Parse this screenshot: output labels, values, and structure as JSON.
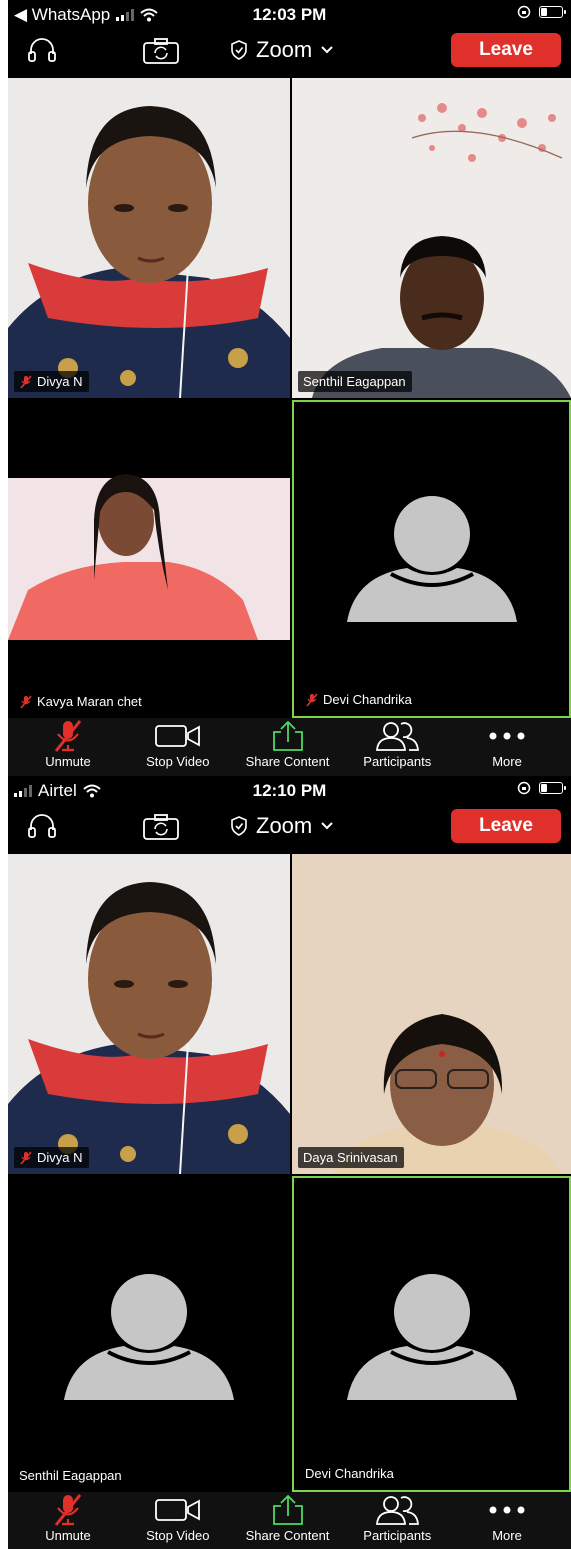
{
  "screens": [
    {
      "status": {
        "left_label": "◀ WhatsApp",
        "time": "12:03 PM"
      },
      "meeting": {
        "title": "Zoom",
        "leave_label": "Leave"
      },
      "tiles": [
        {
          "name": "Divya N",
          "muted": true,
          "video": "divya"
        },
        {
          "name": "Senthil Eagappan",
          "muted": false,
          "video": "senthil"
        },
        {
          "name": "Kavya Maran chet",
          "muted": true,
          "video": "kavya"
        },
        {
          "name": "Devi Chandrika",
          "muted": true,
          "video": "avatar",
          "active": true
        }
      ],
      "toolbar": {
        "unmute": "Unmute",
        "stop_video": "Stop Video",
        "share_content": "Share Content",
        "participants": "Participants",
        "more": "More"
      }
    },
    {
      "status": {
        "left_label": "Airtel",
        "time": "12:10 PM"
      },
      "meeting": {
        "title": "Zoom",
        "leave_label": "Leave"
      },
      "tiles": [
        {
          "name": "Divya N",
          "muted": true,
          "video": "divya"
        },
        {
          "name": "Daya Srinivasan",
          "muted": false,
          "video": "daya"
        },
        {
          "name": "Senthil Eagappan",
          "muted": false,
          "video": "avatar"
        },
        {
          "name": "Devi Chandrika",
          "muted": false,
          "video": "avatar",
          "active": true
        }
      ],
      "toolbar": {
        "unmute": "Unmute",
        "stop_video": "Stop Video",
        "share_content": "Share Content",
        "participants": "Participants",
        "more": "More"
      }
    }
  ],
  "colors": {
    "leave": "#e0302c",
    "active_border": "#7bd44a",
    "muted_red": "#e0302c",
    "share_green": "#4cd964"
  },
  "icons": [
    "headphones-icon",
    "camera-switch-icon",
    "shield-icon",
    "chevron-down-icon",
    "microphone-muted-icon",
    "video-camera-icon",
    "share-upload-icon",
    "participants-icon",
    "more-dots-icon",
    "wifi-icon",
    "signal-icon",
    "battery-icon",
    "orientation-lock-icon"
  ]
}
